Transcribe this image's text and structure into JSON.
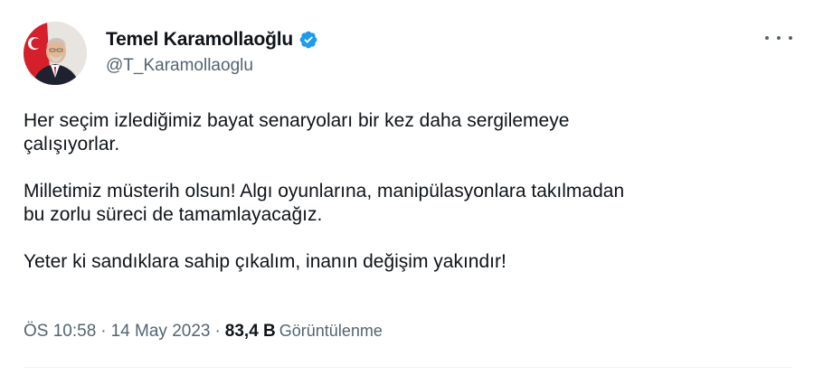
{
  "author": {
    "display_name": "Temel Karamollaoğlu",
    "handle": "@T_Karamollaoglu",
    "verified": true
  },
  "icons": {
    "avatar": "profile-photo",
    "verified": "verified-badge-icon",
    "more": "more-options-icon"
  },
  "colors": {
    "verified_badge": "#1d9bf0",
    "secondary_text": "#536471",
    "primary_text": "#0f1419"
  },
  "tweet": {
    "paragraphs": [
      "Her seçim izlediğimiz bayat senaryoları bir kez daha sergilemeye\nçalışıyorlar.",
      "Milletimiz müsterih olsun! Algı oyunlarına, manipülasyonlara takılmadan\nbu zorlu süreci de tamamlayacağız.",
      "Yeter ki sandıklara sahip çıkalım, inanın değişim yakındır!"
    ],
    "time": "ÖS 10:58",
    "separator": "·",
    "date": "14 May 2023",
    "views_count": "83,4 B",
    "views_label": "Görüntülenme"
  }
}
